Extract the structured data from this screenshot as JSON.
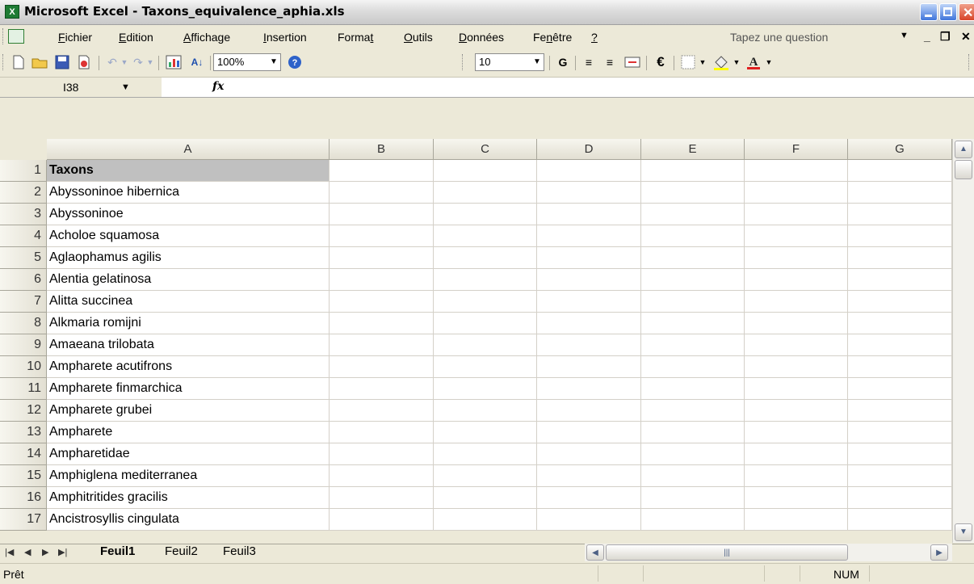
{
  "window": {
    "title": "Microsoft Excel - Taxons_equivalence_aphia.xls"
  },
  "menu": [
    {
      "pre": "",
      "u": "F",
      "post": "ichier"
    },
    {
      "pre": "",
      "u": "E",
      "post": "dition"
    },
    {
      "pre": "",
      "u": "A",
      "post": "ffichage"
    },
    {
      "pre": "",
      "u": "I",
      "post": "nsertion"
    },
    {
      "pre": "Forma",
      "u": "t",
      "post": ""
    },
    {
      "pre": "",
      "u": "O",
      "post": "utils"
    },
    {
      "pre": "",
      "u": "D",
      "post": "onnées"
    },
    {
      "pre": "Fe",
      "u": "n",
      "post": "être"
    },
    {
      "pre": "",
      "u": "?",
      "post": ""
    }
  ],
  "help": {
    "placeholder": "Tapez une question"
  },
  "toolbar": {
    "zoom": "100%",
    "font_size": "10",
    "bold": "G",
    "currency": "€"
  },
  "formula": {
    "cell_ref": "I38",
    "fx": "fx"
  },
  "columns": [
    "A",
    "B",
    "C",
    "D",
    "E",
    "F",
    "G"
  ],
  "rows": [
    {
      "num": "1",
      "a": "Taxons"
    },
    {
      "num": "2",
      "a": "Abyssoninoe hibernica"
    },
    {
      "num": "3",
      "a": "Abyssoninoe"
    },
    {
      "num": "4",
      "a": "Acholoe squamosa"
    },
    {
      "num": "5",
      "a": "Aglaophamus agilis"
    },
    {
      "num": "6",
      "a": "Alentia gelatinosa"
    },
    {
      "num": "7",
      "a": "Alitta succinea"
    },
    {
      "num": "8",
      "a": "Alkmaria romijni"
    },
    {
      "num": "9",
      "a": "Amaeana trilobata"
    },
    {
      "num": "10",
      "a": "Ampharete acutifrons"
    },
    {
      "num": "11",
      "a": "Ampharete finmarchica"
    },
    {
      "num": "12",
      "a": "Ampharete grubei"
    },
    {
      "num": "13",
      "a": "Ampharete"
    },
    {
      "num": "14",
      "a": "Ampharetidae"
    },
    {
      "num": "15",
      "a": "Amphiglena mediterranea"
    },
    {
      "num": "16",
      "a": "Amphitritides gracilis"
    },
    {
      "num": "17",
      "a": "Ancistrosyllis cingulata"
    }
  ],
  "sheets": [
    "Feuil1",
    "Feuil2",
    "Feuil3"
  ],
  "status": {
    "left": "Prêt",
    "num": "NUM"
  }
}
